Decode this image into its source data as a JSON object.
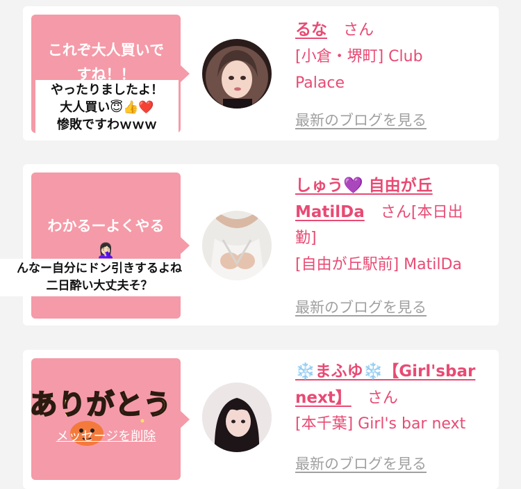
{
  "cards": [
    {
      "bubble_lines": [
        "これぞ大人買いで",
        "すね！！"
      ],
      "sticker_lines": [
        "やったりましたよ！",
        "大人買い😇👍❤️",
        "惨敗ですわｗｗｗ"
      ],
      "name": "るな",
      "san": "さん",
      "location": "[小倉・堺町] Club",
      "shop": "Palace",
      "blog_link": "最新のブログを見る"
    },
    {
      "bubble_lines": [
        "わかるーよくやる",
        "🤦🏻‍♀️"
      ],
      "sticker_lines": [
        "んなー自分にドン引きするよね",
        "二日酔い大丈夫そ？"
      ],
      "name_line1": "しゅう💜 自由が丘",
      "name_line2": "MatilDa",
      "san": "さん",
      "location_part": "[本日出",
      "location_part2": "勤]",
      "location": "[自由が丘駅前] MatilDa",
      "blog_link": "最新のブログを見る"
    },
    {
      "sticker_text": "ありがとう",
      "delete_link": "メッセージを削除",
      "name_line1": "❄️まふゆ❄️【Girl'sbar",
      "name_line2": "next】",
      "san": "さん",
      "location": "[本千葉] Girl's bar next",
      "blog_link": "最新のブログを見る"
    }
  ],
  "colors": {
    "background": "#f3f3f3",
    "card": "#ffffff",
    "bubble": "#f59aa8",
    "accent": "#e84a73",
    "muted": "#a0a0a0"
  }
}
